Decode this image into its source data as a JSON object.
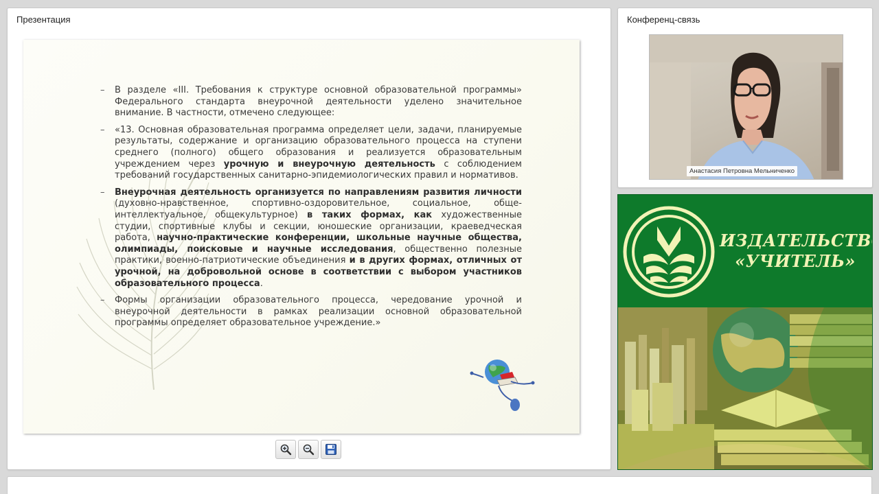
{
  "presentation": {
    "panel_title": "Презентация",
    "slide": {
      "b1": {
        "t1": "В разделе «III. Требования к структуре основной образовательной программы» Федерального стандарта внеурочной деятельности уделено значительное внимание. В частности, отмечено следующее:"
      },
      "b2": {
        "t1": "«13. Основная образовательная программа определяет цели, задачи, планируемые результаты, содержание и организацию образовательного процесса на ступени среднего (полного) общего образования и реализуется образовательным учреждением через ",
        "b1": "урочную и внеурочную деятельность",
        "t2": " с соблюдением требований государственных санитарно-эпидемиологических правил и нормативов."
      },
      "b3": {
        "b1": "Внеурочная деятельность организуется по направлениям развития личности",
        "t1": " (духовно-нравственное, спортивно-оздоровительное, социальное, обще-интеллектуальное, общекультурное) ",
        "b2": "в таких формах, как",
        "t2": " художественные студии, спортивные клубы и секции, юношеские организации, краеведческая работа, ",
        "b3": "научно-практические конференции, школьные научные общества, олимпиады, поисковые и научные исследования",
        "t3": ", общественно полезные практики, военно-патриотические объединения ",
        "b4": "и в других формах, отличных от урочной, на добровольной основе в соответствии с выбором участников образовательного процесса",
        "t4": "."
      },
      "b4": {
        "t1": "Формы организации образовательного процесса, чередование урочной и внеурочной деятельности в рамках реализации основной образовательной программы определяет образовательное учреждение.»"
      }
    },
    "toolbar": {
      "zoom_in_icon": "zoom-in-icon",
      "zoom_out_icon": "zoom-out-icon",
      "save_icon": "save-icon"
    }
  },
  "conference": {
    "panel_title": "Конференц-связь",
    "participant_name": "Анастасия Петровна Мельниченко"
  },
  "publisher": {
    "name_line1": "ИЗДАТЕЛЬСТВО",
    "name_line2": "«УЧИТЕЛЬ»"
  },
  "colors": {
    "banner_green": "#0e7a2b",
    "banner_text": "#f2f3b6",
    "page_background": "#d9d9d9"
  }
}
